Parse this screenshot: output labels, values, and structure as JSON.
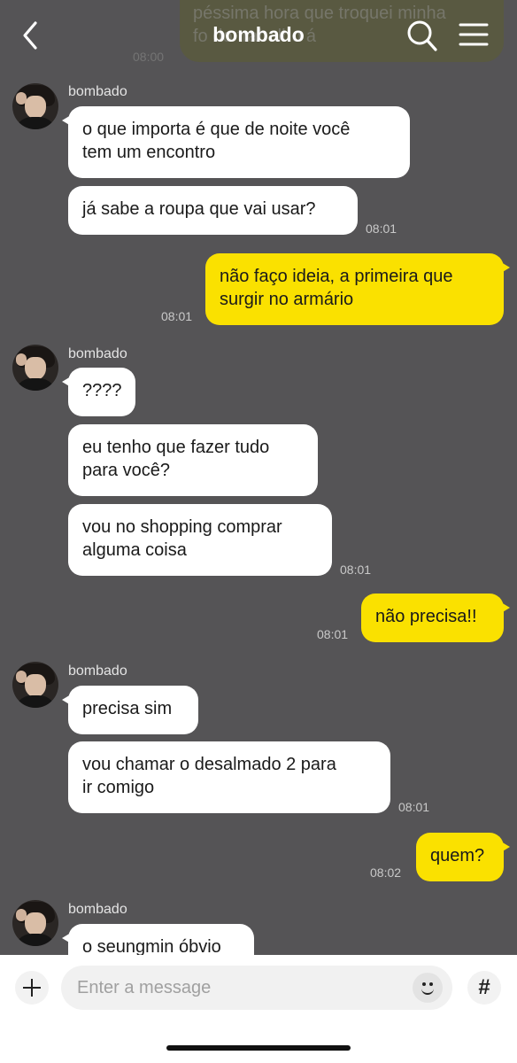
{
  "header": {
    "title": "bombado",
    "back_icon": "chevron-left-icon",
    "search_icon": "search-icon",
    "menu_icon": "hamburger-menu-icon"
  },
  "faded_message": {
    "line1": "péssima hora que troquei minha",
    "line2": "fo              do trabalho    á",
    "time": "08:00"
  },
  "groups": [
    {
      "sender": "bombado",
      "messages": [
        {
          "lines": [
            "o que importa é que de noite você",
            "tem um encontro"
          ]
        },
        {
          "lines": [
            "já sabe a roupa que vai usar?"
          ],
          "time": "08:01"
        }
      ]
    },
    {
      "mine": true,
      "messages": [
        {
          "lines": [
            "não faço ideia, a primeira que",
            "surgir no armário"
          ],
          "time": "08:01"
        }
      ]
    },
    {
      "sender": "bombado",
      "messages": [
        {
          "lines": [
            "????"
          ]
        },
        {
          "lines": [
            "eu tenho que fazer tudo",
            "para você?"
          ]
        },
        {
          "lines": [
            "vou no shopping comprar",
            "alguma coisa"
          ],
          "time": "08:01"
        }
      ]
    },
    {
      "mine": true,
      "messages": [
        {
          "lines": [
            "não precisa!!"
          ],
          "time": "08:01"
        }
      ]
    },
    {
      "sender": "bombado",
      "messages": [
        {
          "lines": [
            "precisa sim"
          ]
        },
        {
          "lines": [
            "vou chamar o desalmado 2 para",
            "ir comigo"
          ],
          "time": "08:01"
        }
      ]
    },
    {
      "mine": true,
      "messages": [
        {
          "lines": [
            "quem?"
          ],
          "time": "08:02"
        }
      ]
    },
    {
      "sender": "bombado",
      "messages": [
        {
          "lines": [
            "o seungmin óbvio"
          ]
        }
      ]
    }
  ],
  "input": {
    "placeholder": "Enter a message",
    "plus_icon": "plus-icon",
    "emoji_icon": "emoji-icon",
    "hash_icon": "hash-icon",
    "hash_label": "#"
  },
  "colors": {
    "background": "#555456",
    "my_bubble": "#fae100",
    "their_bubble": "#ffffff"
  }
}
